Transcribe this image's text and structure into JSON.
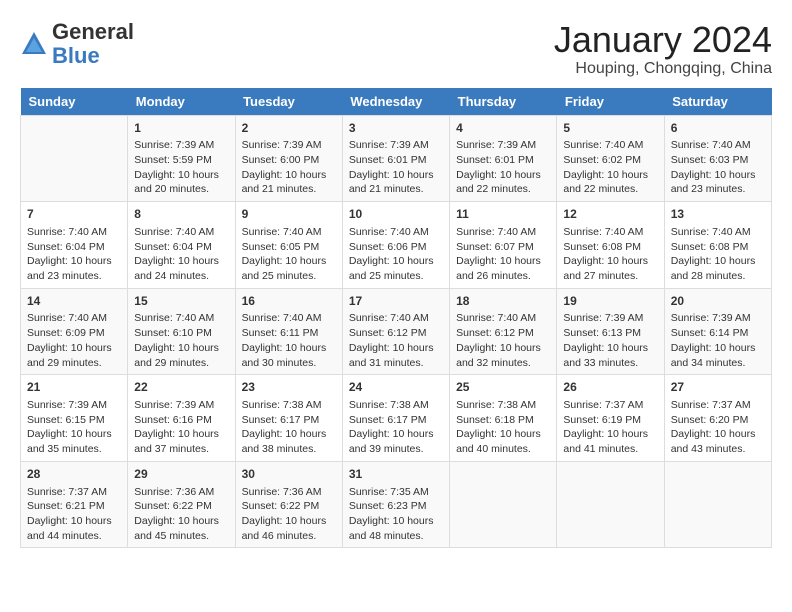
{
  "header": {
    "logo_general": "General",
    "logo_blue": "Blue",
    "main_title": "January 2024",
    "subtitle": "Houping, Chongqing, China"
  },
  "days_of_week": [
    "Sunday",
    "Monday",
    "Tuesday",
    "Wednesday",
    "Thursday",
    "Friday",
    "Saturday"
  ],
  "weeks": [
    [
      {
        "day": "",
        "content": ""
      },
      {
        "day": "1",
        "content": "Sunrise: 7:39 AM\nSunset: 5:59 PM\nDaylight: 10 hours and 20 minutes."
      },
      {
        "day": "2",
        "content": "Sunrise: 7:39 AM\nSunset: 6:00 PM\nDaylight: 10 hours and 21 minutes."
      },
      {
        "day": "3",
        "content": "Sunrise: 7:39 AM\nSunset: 6:01 PM\nDaylight: 10 hours and 21 minutes."
      },
      {
        "day": "4",
        "content": "Sunrise: 7:39 AM\nSunset: 6:01 PM\nDaylight: 10 hours and 22 minutes."
      },
      {
        "day": "5",
        "content": "Sunrise: 7:40 AM\nSunset: 6:02 PM\nDaylight: 10 hours and 22 minutes."
      },
      {
        "day": "6",
        "content": "Sunrise: 7:40 AM\nSunset: 6:03 PM\nDaylight: 10 hours and 23 minutes."
      }
    ],
    [
      {
        "day": "7",
        "content": "Sunrise: 7:40 AM\nSunset: 6:04 PM\nDaylight: 10 hours and 23 minutes."
      },
      {
        "day": "8",
        "content": "Sunrise: 7:40 AM\nSunset: 6:04 PM\nDaylight: 10 hours and 24 minutes."
      },
      {
        "day": "9",
        "content": "Sunrise: 7:40 AM\nSunset: 6:05 PM\nDaylight: 10 hours and 25 minutes."
      },
      {
        "day": "10",
        "content": "Sunrise: 7:40 AM\nSunset: 6:06 PM\nDaylight: 10 hours and 25 minutes."
      },
      {
        "day": "11",
        "content": "Sunrise: 7:40 AM\nSunset: 6:07 PM\nDaylight: 10 hours and 26 minutes."
      },
      {
        "day": "12",
        "content": "Sunrise: 7:40 AM\nSunset: 6:08 PM\nDaylight: 10 hours and 27 minutes."
      },
      {
        "day": "13",
        "content": "Sunrise: 7:40 AM\nSunset: 6:08 PM\nDaylight: 10 hours and 28 minutes."
      }
    ],
    [
      {
        "day": "14",
        "content": "Sunrise: 7:40 AM\nSunset: 6:09 PM\nDaylight: 10 hours and 29 minutes."
      },
      {
        "day": "15",
        "content": "Sunrise: 7:40 AM\nSunset: 6:10 PM\nDaylight: 10 hours and 29 minutes."
      },
      {
        "day": "16",
        "content": "Sunrise: 7:40 AM\nSunset: 6:11 PM\nDaylight: 10 hours and 30 minutes."
      },
      {
        "day": "17",
        "content": "Sunrise: 7:40 AM\nSunset: 6:12 PM\nDaylight: 10 hours and 31 minutes."
      },
      {
        "day": "18",
        "content": "Sunrise: 7:40 AM\nSunset: 6:12 PM\nDaylight: 10 hours and 32 minutes."
      },
      {
        "day": "19",
        "content": "Sunrise: 7:39 AM\nSunset: 6:13 PM\nDaylight: 10 hours and 33 minutes."
      },
      {
        "day": "20",
        "content": "Sunrise: 7:39 AM\nSunset: 6:14 PM\nDaylight: 10 hours and 34 minutes."
      }
    ],
    [
      {
        "day": "21",
        "content": "Sunrise: 7:39 AM\nSunset: 6:15 PM\nDaylight: 10 hours and 35 minutes."
      },
      {
        "day": "22",
        "content": "Sunrise: 7:39 AM\nSunset: 6:16 PM\nDaylight: 10 hours and 37 minutes."
      },
      {
        "day": "23",
        "content": "Sunrise: 7:38 AM\nSunset: 6:17 PM\nDaylight: 10 hours and 38 minutes."
      },
      {
        "day": "24",
        "content": "Sunrise: 7:38 AM\nSunset: 6:17 PM\nDaylight: 10 hours and 39 minutes."
      },
      {
        "day": "25",
        "content": "Sunrise: 7:38 AM\nSunset: 6:18 PM\nDaylight: 10 hours and 40 minutes."
      },
      {
        "day": "26",
        "content": "Sunrise: 7:37 AM\nSunset: 6:19 PM\nDaylight: 10 hours and 41 minutes."
      },
      {
        "day": "27",
        "content": "Sunrise: 7:37 AM\nSunset: 6:20 PM\nDaylight: 10 hours and 43 minutes."
      }
    ],
    [
      {
        "day": "28",
        "content": "Sunrise: 7:37 AM\nSunset: 6:21 PM\nDaylight: 10 hours and 44 minutes."
      },
      {
        "day": "29",
        "content": "Sunrise: 7:36 AM\nSunset: 6:22 PM\nDaylight: 10 hours and 45 minutes."
      },
      {
        "day": "30",
        "content": "Sunrise: 7:36 AM\nSunset: 6:22 PM\nDaylight: 10 hours and 46 minutes."
      },
      {
        "day": "31",
        "content": "Sunrise: 7:35 AM\nSunset: 6:23 PM\nDaylight: 10 hours and 48 minutes."
      },
      {
        "day": "",
        "content": ""
      },
      {
        "day": "",
        "content": ""
      },
      {
        "day": "",
        "content": ""
      }
    ]
  ]
}
